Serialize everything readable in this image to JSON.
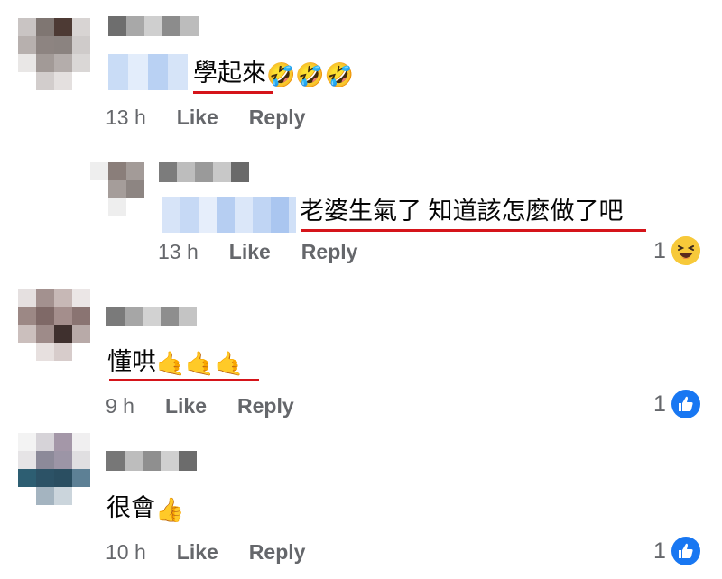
{
  "comments": [
    {
      "text": "學起來",
      "emojis": "🤣🤣🤣",
      "time": "13 h",
      "like_label": "Like",
      "reply_label": "Reply"
    },
    {
      "text": "老婆生氣了 知道該怎麼做了吧",
      "time": "13 h",
      "like_label": "Like",
      "reply_label": "Reply",
      "reaction_count": "1",
      "reaction_icon": "haha-icon"
    },
    {
      "text": "懂哄",
      "emojis": "🤙🤙🤙",
      "time": "9 h",
      "like_label": "Like",
      "reply_label": "Reply",
      "reaction_count": "1",
      "reaction_icon": "like-icon"
    },
    {
      "text": "很會",
      "emojis": "👍",
      "time": "10 h",
      "like_label": "Like",
      "reply_label": "Reply",
      "reaction_count": "1",
      "reaction_icon": "like-icon"
    }
  ],
  "colors": {
    "underline": "#d5141a",
    "meta_text": "#65676b",
    "like_blue": "#1877f2",
    "haha_yellow": "#f7c93a"
  }
}
